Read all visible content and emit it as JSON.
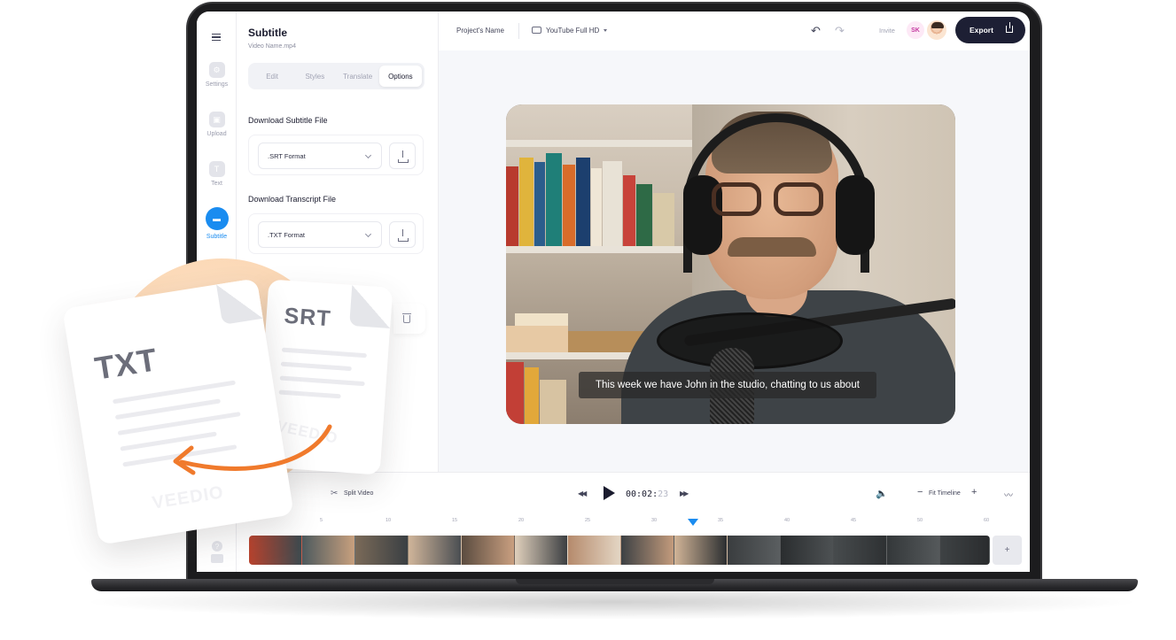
{
  "rail": {
    "items": [
      {
        "label": "Settings"
      },
      {
        "label": "Upload"
      },
      {
        "label": "Text"
      },
      {
        "label": "Subtitle"
      }
    ]
  },
  "panel": {
    "title": "Subtitle",
    "file_name": "Video Name.mp4",
    "tabs": [
      "Edit",
      "Styles",
      "Translate",
      "Options"
    ],
    "active_tab": "Options",
    "subtitle_section": "Download Subtitle File",
    "subtitle_format": ".SRT Format",
    "transcript_section": "Download Transcript File",
    "transcript_format": ".TXT Format"
  },
  "topbar": {
    "project_name": "Project's Name",
    "resolution": "YouTube Full HD",
    "invite": "Invite",
    "user_initials": "SK",
    "export_label": "Export"
  },
  "video": {
    "caption": "This week we have John in the studio, chatting to us about"
  },
  "player": {
    "split_label": "Split Video",
    "time_main": "00:02:",
    "time_frame": "23",
    "fit_label": "Fit Timeline",
    "minus": "−",
    "plus": "+"
  },
  "timeline": {
    "ticks": [
      "5",
      "10",
      "15",
      "20",
      "25",
      "30",
      "35",
      "40",
      "45",
      "50",
      "60"
    ],
    "add_label": "+"
  },
  "overlay": {
    "srt_label": "SRT",
    "txt_label": "TXT",
    "watermark": "VEEDIO"
  },
  "colors": {
    "accent": "#1a8cf0",
    "dark": "#1d1f34",
    "arrow": "#f07a2c"
  }
}
